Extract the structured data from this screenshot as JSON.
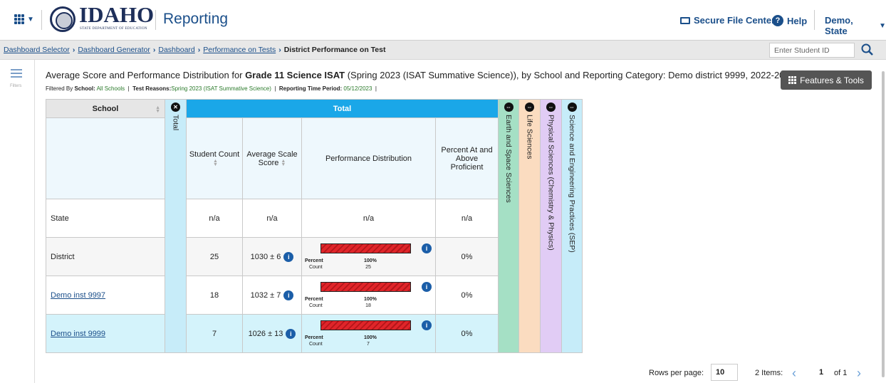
{
  "header": {
    "logo_word": "IDAHO",
    "logo_sub": "STATE DEPARTMENT OF EDUCATION",
    "app_name": "Reporting",
    "secure_file_center": "Secure File Center",
    "help": "Help",
    "user": "Demo, State"
  },
  "breadcrumbs": {
    "items": [
      "Dashboard Selector",
      "Dashboard Generator",
      "Dashboard",
      "Performance on Tests"
    ],
    "current": "District Performance on Test"
  },
  "student_search": {
    "placeholder": "Enter Student ID"
  },
  "left_rail": {
    "filters_label": "Filters"
  },
  "report": {
    "title_pre": "Average Score and Performance Distribution for ",
    "title_bold": "Grade 11 Science ISAT",
    "title_post": " (Spring 2023 (ISAT Summative Science)), by School and Reporting Category: Demo district 9999, 2022-2023",
    "filter_school_label": "School:",
    "filter_school_value": "All Schools",
    "filter_reasons_label": "Test Reasons:",
    "filter_reasons_value": "Spring 2023 (ISAT Summative Science)",
    "filter_period_label": "Reporting Time Period:",
    "filter_period_value": "05/12/2023",
    "features_tools": "Features & Tools"
  },
  "table": {
    "col_school": "School",
    "col_total_side": "Total",
    "col_total": "Total",
    "sub_student_count": "Student Count",
    "sub_avg_scale": "Average Scale Score",
    "sub_perf_dist": "Performance Distribution",
    "sub_pct_proficient": "Percent At and Above Proficient",
    "categories": [
      {
        "label": "Earth and Space Sciences",
        "color": "#a5e0c5"
      },
      {
        "label": "Life Sciences",
        "color": "#fbdcc0"
      },
      {
        "label": "Physical Sciences (Chemistry & Physics)",
        "color": "#e1ccf5"
      },
      {
        "label": "Science and Engineering Practices (SEP)",
        "color": "#c6ecf9"
      }
    ],
    "bar_percent_label": "Percent",
    "bar_count_label": "Count",
    "rows": [
      {
        "school": "State",
        "count": "n/a",
        "avg": "n/a",
        "dist": "n/a",
        "pct": "n/a"
      },
      {
        "school": "District",
        "count": "25",
        "avg": "1030 ± 6",
        "bar_percent": "100%",
        "bar_count": "25",
        "pct": "0%"
      },
      {
        "school": "Demo inst 9997",
        "count": "18",
        "avg": "1032 ± 7",
        "bar_percent": "100%",
        "bar_count": "18",
        "pct": "0%"
      },
      {
        "school": "Demo inst 9999",
        "count": "7",
        "avg": "1026 ± 13",
        "bar_percent": "100%",
        "bar_count": "7",
        "pct": "0%"
      }
    ]
  },
  "pagination": {
    "rows_per_page_label": "Rows per page:",
    "rows_per_page": "10",
    "items": "2 Items:",
    "page": "1",
    "of": "of 1"
  }
}
